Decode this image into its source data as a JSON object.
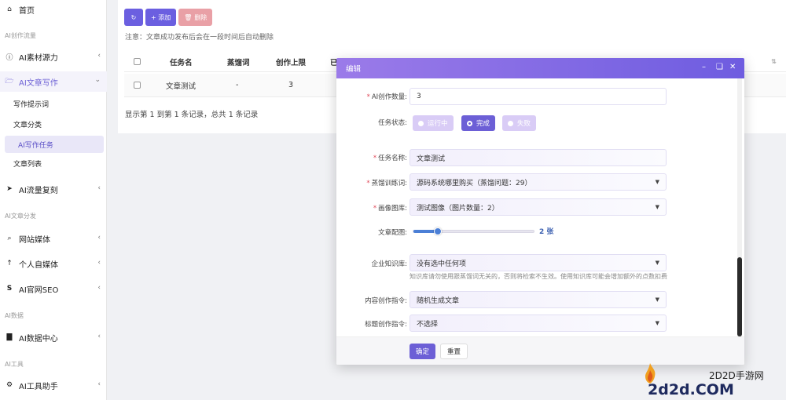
{
  "sidebar": {
    "home": "首页",
    "cat_ai_create": "AI创作流量",
    "item_material": "AI素材源力",
    "item_writing": "AI文章写作",
    "sub_prompt": "写作提示词",
    "sub_category": "文章分类",
    "sub_task": "AI写作任务",
    "sub_list": "文章列表",
    "item_traffic": "AI流量复刻",
    "cat_distribute": "AI文章分发",
    "item_site": "网站媒体",
    "item_self_media": "个人自媒体",
    "item_seo": "AI官网SEO",
    "cat_data": "AI数据",
    "item_data": "AI数据中心",
    "cat_tools": "AI工具",
    "item_tools": "AI工具助手"
  },
  "toolbar": {
    "add_label": "+ 添加",
    "delete_label": "删除"
  },
  "notice": "注意：文章成功发布后会在一段时间后自动删除",
  "table": {
    "headers": [
      "任务名",
      "蒸馏词",
      "创作上限",
      "已"
    ],
    "rows": [
      {
        "name": "文章测试",
        "word": "-",
        "limit": "3"
      }
    ]
  },
  "pager": "显示第 1 到第 1 条记录，总共 1 条记录",
  "modal": {
    "title": "编辑",
    "fields": {
      "count_label": "AI创作数量:",
      "count_value": "3",
      "status_label": "任务状态:",
      "status_options": [
        "运行中",
        "完成",
        "失败"
      ],
      "status_selected": "完成",
      "name_label": "任务名称:",
      "name_value": "文章测试",
      "word_label": "蒸馏训练词:",
      "word_value": "源码系统哪里购买（蒸馏问题：29）",
      "image_label": "画像图库:",
      "image_value": "测试图像（图片数量：2）",
      "pic_label": "文章配图:",
      "pic_value_text": "2 张",
      "pic_value": 2,
      "pic_max": 10,
      "kb_label": "企业知识库:",
      "kb_value": "没有选中任何项",
      "kb_hint": "知识库请勿使用跟蒸馏词无关的，否则将检索不生效。使用知识库可能会增加额外的点数扣费",
      "content_label": "内容创作指令:",
      "content_value": "随机生成文章",
      "title_label": "标题创作指令:",
      "title_value": "不选择"
    },
    "ok_label": "确定",
    "reset_label": "重置"
  },
  "brand": {
    "cn": "2D2D手游网",
    "en": "2d2d.COM"
  },
  "colors": {
    "accent": "#6c5fd6",
    "header_start": "#9b7be9",
    "header_end": "#6e5ce0",
    "danger_soft": "#e9a0a6",
    "slider": "#4b7fd6"
  }
}
